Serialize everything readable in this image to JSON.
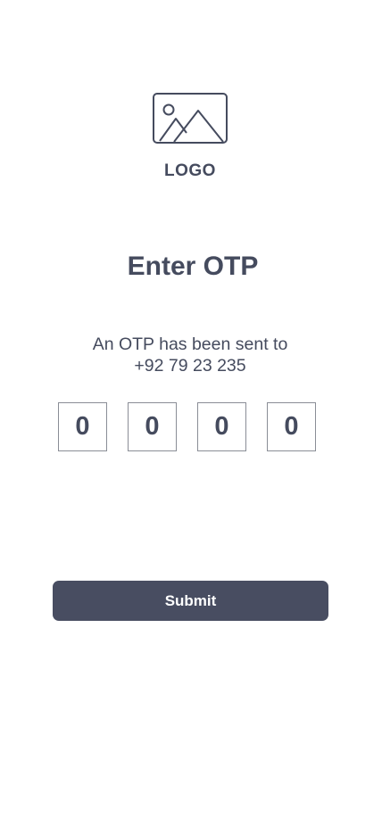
{
  "logo": {
    "icon": "image-placeholder-icon",
    "text": "LOGO"
  },
  "title": "Enter OTP",
  "message": {
    "line1": "An OTP has been sent to",
    "line2": "+92 79 23 235"
  },
  "otp": {
    "digits": [
      "0",
      "0",
      "0",
      "0"
    ]
  },
  "submit_button": {
    "label": "Submit"
  },
  "colors": {
    "text": "#454b5e",
    "button_bg": "#484d61",
    "button_text": "#ffffff",
    "box_border": "#8a8d96"
  }
}
